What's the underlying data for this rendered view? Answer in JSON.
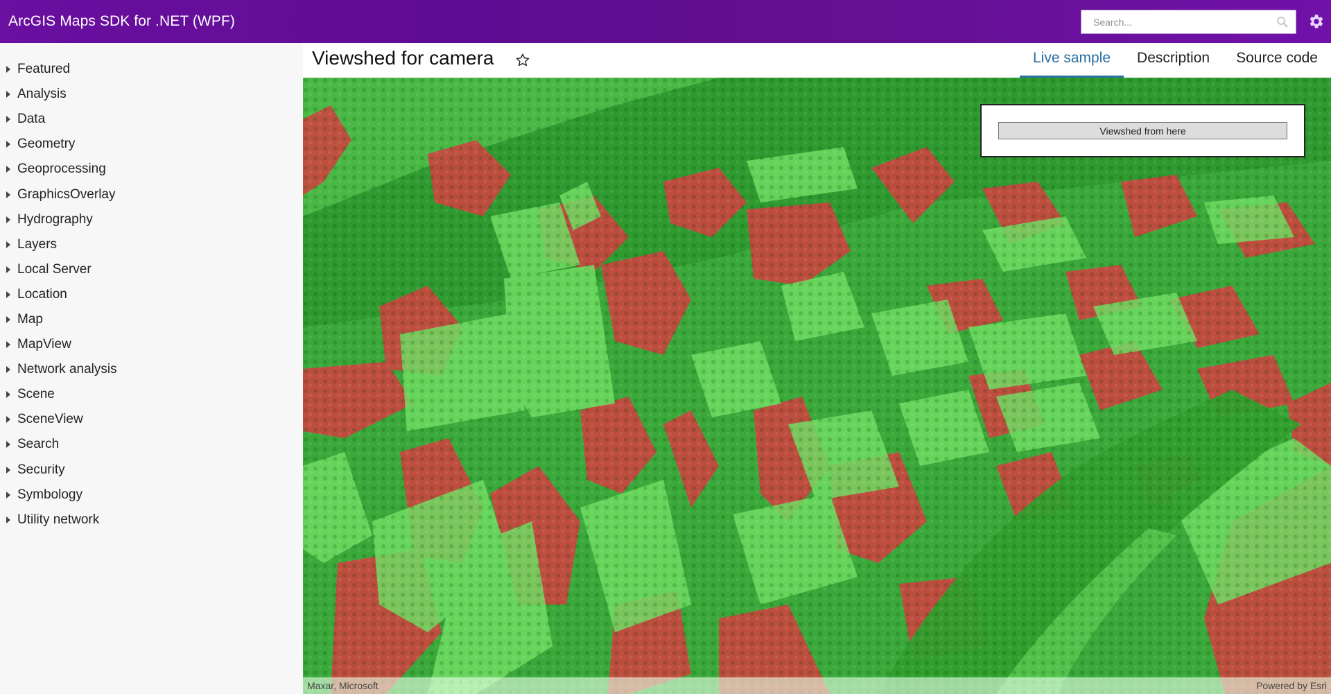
{
  "app": {
    "title": "ArcGIS Maps SDK for .NET (WPF)",
    "search_placeholder": "Search...",
    "search_value": "",
    "accent_color": "#6a0fa0"
  },
  "sidebar": {
    "items": [
      {
        "label": "Featured"
      },
      {
        "label": "Analysis"
      },
      {
        "label": "Data"
      },
      {
        "label": "Geometry"
      },
      {
        "label": "Geoprocessing"
      },
      {
        "label": "GraphicsOverlay"
      },
      {
        "label": "Hydrography"
      },
      {
        "label": "Layers"
      },
      {
        "label": "Local Server"
      },
      {
        "label": "Location"
      },
      {
        "label": "Map"
      },
      {
        "label": "MapView"
      },
      {
        "label": "Network analysis"
      },
      {
        "label": "Scene"
      },
      {
        "label": "SceneView"
      },
      {
        "label": "Search"
      },
      {
        "label": "Security"
      },
      {
        "label": "Symbology"
      },
      {
        "label": "Utility network"
      }
    ]
  },
  "main": {
    "title": "Viewshed for camera",
    "tabs": [
      {
        "label": "Live sample",
        "active": true
      },
      {
        "label": "Description",
        "active": false
      },
      {
        "label": "Source code",
        "active": false
      }
    ],
    "active_tab_color": "#2a6f9f"
  },
  "map": {
    "visible_color": "#33cc33",
    "obstructed_color": "#cc3333",
    "panel": {
      "button_label": "Viewshed from here"
    },
    "attribution_left": "Maxar, Microsoft",
    "attribution_right": "Powered by Esri"
  }
}
